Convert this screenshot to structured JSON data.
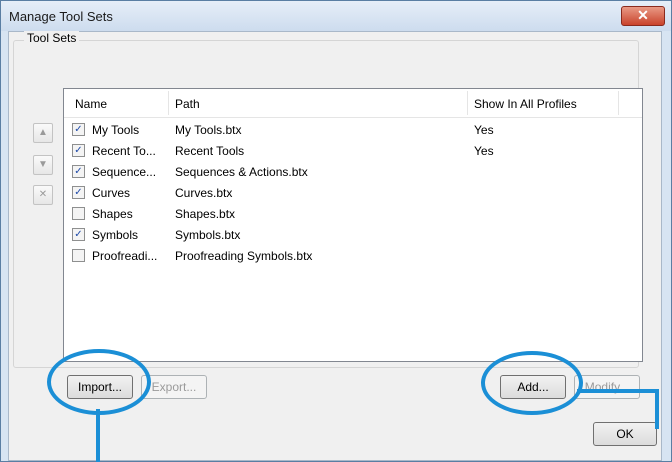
{
  "window": {
    "title": "Manage Tool Sets",
    "close_glyph": "✕"
  },
  "group": {
    "label": "Tool Sets"
  },
  "side_buttons": {
    "up": "▲",
    "down": "▼",
    "delete": "✕"
  },
  "columns": {
    "name": "Name",
    "path": "Path",
    "show": "Show In All Profiles"
  },
  "rows": [
    {
      "checked": true,
      "check_glyph": "✓",
      "name": "My Tools",
      "path": "My Tools.btx",
      "show": "Yes"
    },
    {
      "checked": true,
      "check_glyph": "✓",
      "name": "Recent To...",
      "path": "Recent Tools",
      "show": "Yes"
    },
    {
      "checked": true,
      "check_glyph": "✓",
      "name": "Sequence...",
      "path": "Sequences & Actions.btx",
      "show": ""
    },
    {
      "checked": true,
      "check_glyph": "✓",
      "name": "Curves",
      "path": "Curves.btx",
      "show": ""
    },
    {
      "checked": false,
      "check_glyph": "",
      "name": "Shapes",
      "path": "Shapes.btx",
      "show": ""
    },
    {
      "checked": true,
      "check_glyph": "✓",
      "name": "Symbols",
      "path": "Symbols.btx",
      "show": ""
    },
    {
      "checked": false,
      "check_glyph": "",
      "name": "Proofreadi...",
      "path": "Proofreading Symbols.btx",
      "show": ""
    }
  ],
  "buttons": {
    "import": "Import...",
    "export": "Export...",
    "add": "Add...",
    "modify": "Modify...",
    "ok": "OK"
  },
  "colors": {
    "highlight_ring": "#1b8fd6",
    "title_bar": "#d7e4f2",
    "close_button": "#c9432c"
  }
}
